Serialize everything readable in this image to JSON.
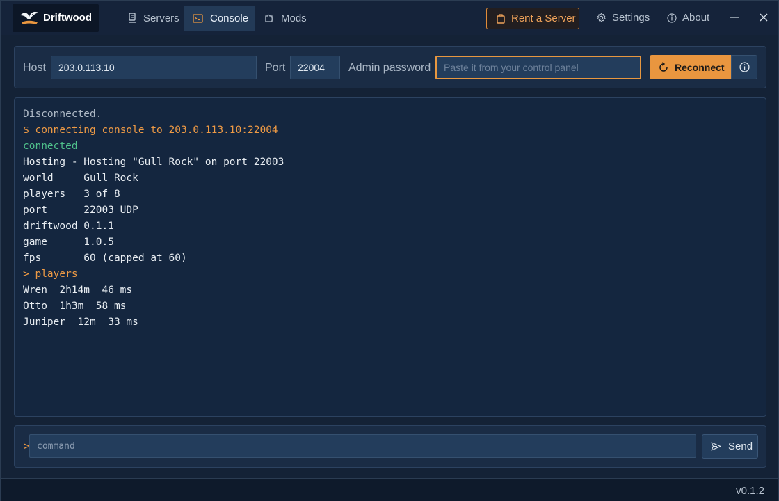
{
  "app": {
    "name": "Driftwood"
  },
  "nav": {
    "tabs": [
      {
        "label": "Servers",
        "icon": "server-icon"
      },
      {
        "label": "Console",
        "icon": "terminal-icon",
        "active": true
      },
      {
        "label": "Mods",
        "icon": "puzzle-icon"
      }
    ],
    "rent_label": "Rent a Server",
    "settings_label": "Settings",
    "about_label": "About"
  },
  "connection": {
    "host_label": "Host",
    "host_value": "203.0.113.10",
    "port_label": "Port",
    "port_value": "22004",
    "password_label": "Admin password",
    "password_placeholder": "Paste it from your control panel",
    "reconnect_label": "Reconnect"
  },
  "console": {
    "lines": [
      {
        "text": "Disconnected.",
        "style": "muted"
      },
      {
        "text": "$ connecting console to 203.0.113.10:22004",
        "style": "cmd"
      },
      {
        "text": "connected",
        "style": "ok"
      },
      {
        "text": "Hosting - Hosting \"Gull Rock\" on port 22003",
        "style": "normal"
      },
      {
        "text": "world     Gull Rock",
        "style": "normal"
      },
      {
        "text": "players   3 of 8",
        "style": "normal"
      },
      {
        "text": "port      22003 UDP",
        "style": "normal"
      },
      {
        "text": "driftwood 0.1.1",
        "style": "normal"
      },
      {
        "text": "game      1.0.5",
        "style": "normal"
      },
      {
        "text": "fps       60 (capped at 60)",
        "style": "normal"
      },
      {
        "text": "> players",
        "style": "cmd"
      },
      {
        "text": "Wren  2h14m  46 ms",
        "style": "normal"
      },
      {
        "text": "Otto  1h3m  58 ms",
        "style": "normal"
      },
      {
        "text": "Juniper  12m  33 ms",
        "style": "normal"
      }
    ]
  },
  "command_bar": {
    "prompt": ">",
    "placeholder": "command",
    "send_label": "Send"
  },
  "status": {
    "version": "v0.1.2"
  },
  "colors": {
    "accent": "#e9963f",
    "background": "#142236",
    "panel": "#1a2c45",
    "success": "#4fc08b"
  }
}
